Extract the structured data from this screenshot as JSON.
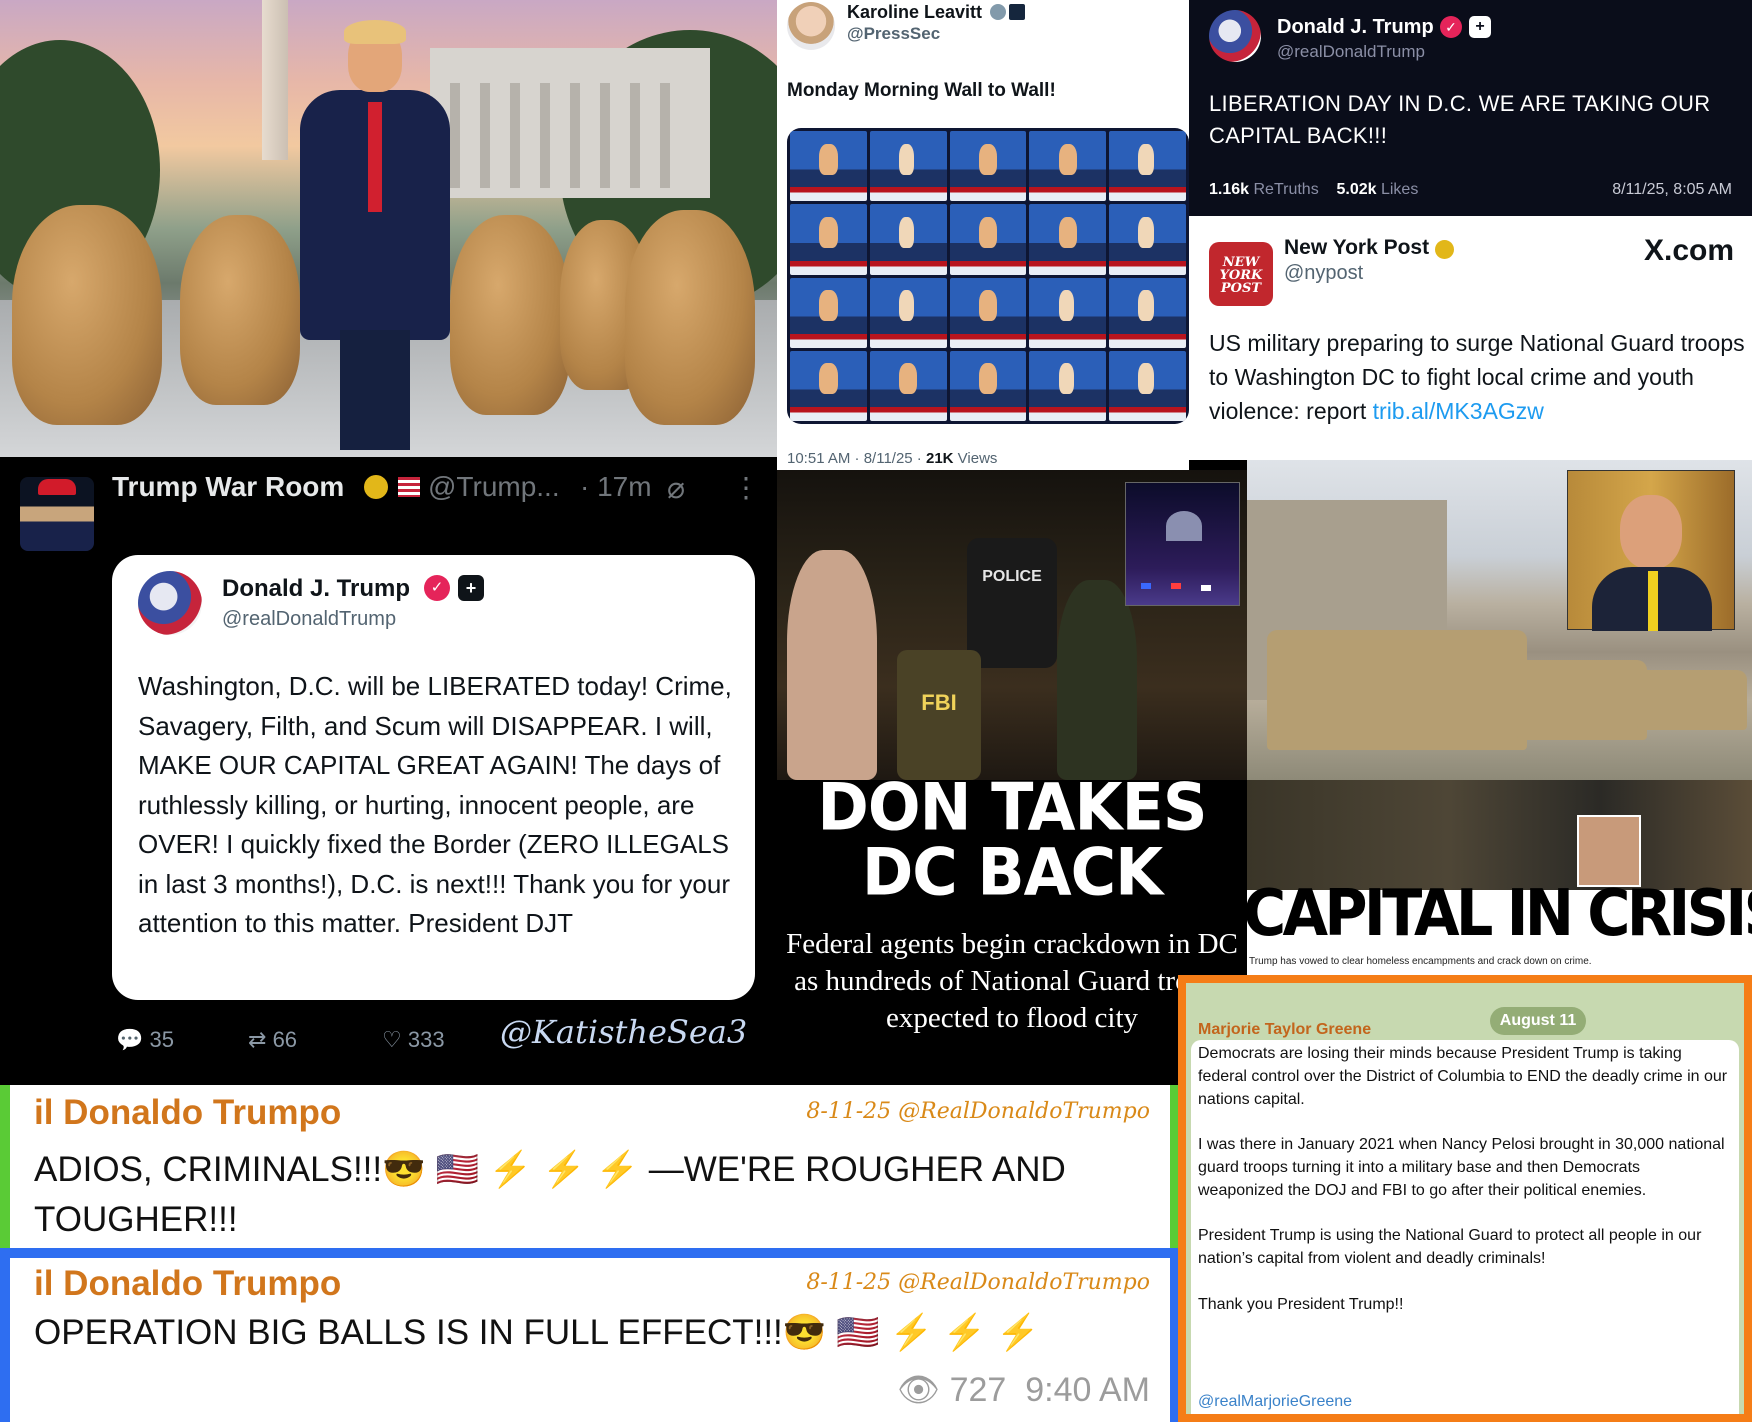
{
  "karoline": {
    "name": "Karoline Leavitt",
    "handle": "@PressSec",
    "text": "Monday Morning Wall to Wall!",
    "time": "10:51 AM · 8/11/25 · ",
    "views_count": "21K",
    "views_label": " Views"
  },
  "truth_top": {
    "name": "Donald J. Trump",
    "handle": "@realDonaldTrump",
    "text": "LIBERATION DAY IN D.C. WE ARE TAKING OUR CAPITAL BACK!!!",
    "retruths": "1.16k",
    "retruths_label": " ReTruths",
    "likes": "5.02k",
    "likes_label": " Likes",
    "date": "8/11/25, 8:05 AM"
  },
  "nypost": {
    "logo": "NEW YORK POST",
    "name": "New York Post",
    "handle": "@nypost",
    "source": "X.com",
    "text": "US military preparing to surge National Guard troops to Washington DC to fight local crime and youth violence: report ",
    "link": "trib.al/MK3AGzw"
  },
  "war_room": {
    "name": "Trump War Room",
    "handle": "@Trump...",
    "time": "· 17m",
    "card_name": "Donald J. Trump",
    "card_handle": "@realDonaldTrump",
    "card_text": "Washington, D.C. will be LIBERATED today! Crime, Savagery, Filth, and Scum will DISAPPEAR. I will, MAKE OUR CAPITAL GREAT AGAIN! The days of ruthlessly killing, or hurting, innocent people, are OVER! I quickly fixed the Border (ZERO ILLEGALS in last 3 months!), D.C. is next!!! Thank you for your attention to this matter. President DJT",
    "replies": "35",
    "retweets": "66",
    "likes": "333",
    "signature": "@KatistheSea3"
  },
  "dtdc": {
    "police_label": "POLICE",
    "fbi_label": "FBI",
    "headline_1": "DON TAKES",
    "headline_2": "DC BACK",
    "sub": "Federal agents begin crackdown in DC as hundreds of National Guard troops expected to flood city"
  },
  "crisis": {
    "title": "CAPITAL IN CRISIS",
    "caption": "Trump has vowed to clear homeless encampments and crack down on crime."
  },
  "telegram_1": {
    "name": "il Donaldo Trumpo",
    "signature": "8-11-25 @RealDonaldoTrumpo",
    "text": "ADIOS, CRIMINALS!!!",
    "text_end": " —WE'RE ROUGHER AND TOUGHER!!!"
  },
  "telegram_2": {
    "name": "il Donaldo Trumpo",
    "signature": "8-11-25 @RealDonaldoTrumpo",
    "text": "OPERATION BIG BALLS IS IN FULL EFFECT!!!",
    "views": "727",
    "time": "9:40 AM"
  },
  "mtg": {
    "date": "August 11",
    "author": "Marjorie Taylor Greene",
    "p1": "Democrats are losing their minds because President Trump is taking federal control over the District of Columbia to END the deadly crime in our nations capital.",
    "p2": "I was there in January 2021 when Nancy Pelosi brought in 30,000 national guard troops turning it into a military base and then Democrats weaponized the DOJ and FBI to go after their political enemies.",
    "p3": "President Trump is using the National Guard to protect all people in our nation’s capital from violent and deadly criminals!",
    "p4": "Thank you President Trump!!",
    "mention": "@realMarjorieGreene"
  },
  "colors": {
    "truth_pink": "#e5245a",
    "x_blue_link": "#1d9bf0",
    "telegram_orange_name": "#d1761c",
    "green_border": "#5acb36",
    "blue_border": "#2e6ef1",
    "orange_border": "#f57d17"
  },
  "icons": [
    "verified-icon",
    "plus-icon",
    "reply-icon",
    "retweet-icon",
    "like-icon",
    "grok-icon",
    "more-icon",
    "eye-icon",
    "sunglasses-emoji",
    "us-flag-emoji",
    "lightning-emoji"
  ]
}
